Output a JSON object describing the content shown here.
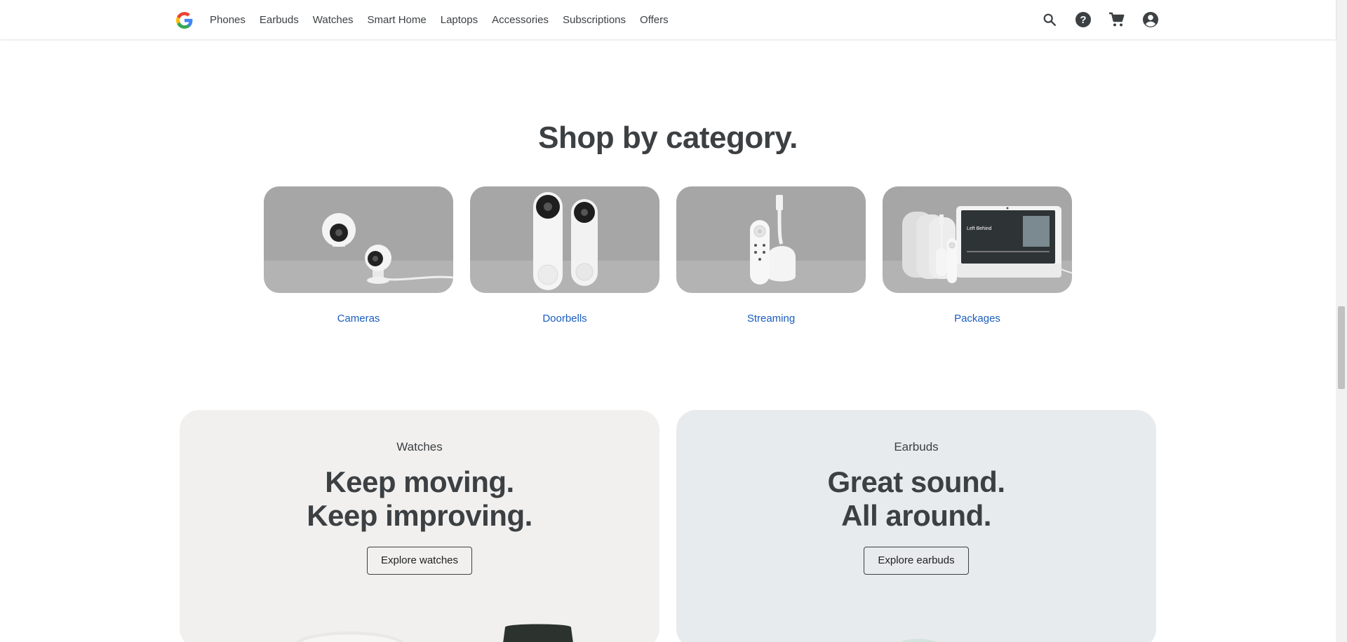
{
  "header": {
    "logo": "google-logo",
    "nav": [
      "Phones",
      "Earbuds",
      "Watches",
      "Smart Home",
      "Laptops",
      "Accessories",
      "Subscriptions",
      "Offers"
    ],
    "icons": [
      "search-icon",
      "help-icon",
      "cart-icon",
      "account-icon"
    ]
  },
  "shop_by_category": {
    "title": "Shop by category.",
    "items": [
      {
        "label": "Cameras",
        "image": "cameras-image"
      },
      {
        "label": "Doorbells",
        "image": "doorbells-image"
      },
      {
        "label": "Streaming",
        "image": "streaming-image"
      },
      {
        "label": "Packages",
        "image": "packages-image"
      }
    ],
    "package_screen_text": "Left Behind"
  },
  "promos": {
    "watches": {
      "eyebrow": "Watches",
      "headline_1": "Keep moving.",
      "headline_2": "Keep improving.",
      "button": "Explore watches"
    },
    "earbuds": {
      "eyebrow": "Earbuds",
      "headline_1": "Great sound.",
      "headline_2": "All around.",
      "button": "Explore earbuds"
    }
  },
  "colors": {
    "link": "#1a5dbf",
    "text": "#3c4043",
    "watches_bg": "#f1f0ee",
    "earbuds_bg": "#e8ebee",
    "category_bg": "#a6a6a6"
  }
}
